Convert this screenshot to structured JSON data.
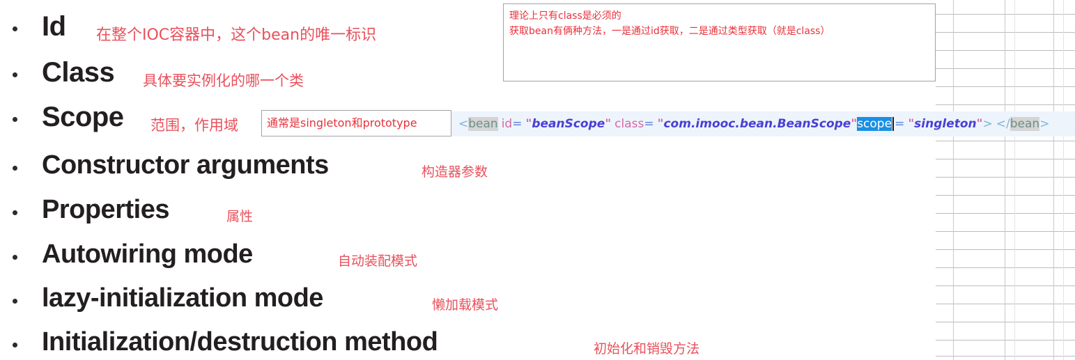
{
  "bullet_list": {
    "items": [
      {
        "term": "Id",
        "annotation": "在整个IOC容器中，这个bean的唯一标识"
      },
      {
        "term": "Class",
        "annotation": "具体要实例化的哪一个类"
      },
      {
        "term": "Scope",
        "annotation": "范围，作用域"
      },
      {
        "term": "Constructor arguments",
        "annotation": "构造器参数"
      },
      {
        "term": "Properties",
        "annotation": "属性"
      },
      {
        "term": "Autowiring mode",
        "annotation": "自动装配模式"
      },
      {
        "term": "lazy-initialization mode",
        "annotation": "懒加载模式"
      },
      {
        "term": "Initialization/destruction  method",
        "annotation": "初始化和销毁方法"
      }
    ]
  },
  "notes": {
    "top_box": {
      "line1": "理论上只有class是必须的",
      "line2": "获取bean有俩种方法，一是通过id获取，二是通过类型获取（就是class）"
    },
    "scope_box": {
      "text": "通常是singleton和prototype"
    }
  },
  "code_line": {
    "open_angle": "<",
    "tag_open": "bean",
    "attr_id": "id",
    "eq1": "=",
    "quote_open_1": "\"",
    "value_id": "beanScope",
    "quote_close_1": "\"",
    "attr_class": "class",
    "eq2": "=",
    "quote_open_2": "\"",
    "value_class": "com.imooc.bean.BeanScope",
    "quote_close_2": "\"",
    "attr_scope_selected": "scope",
    "eq3": "=",
    "quote_open_3": "\"",
    "value_scope": "singleton",
    "quote_close_3": "\"",
    "close_angle": ">",
    "close_tag_open": "</",
    "tag_close": "bean",
    "close_tag_end": ">"
  },
  "colors": {
    "annotation_red": "#e8505b",
    "note_red": "#e8303a",
    "selection_blue": "#1a8fe3",
    "xml_value_blue": "#4a3fd4",
    "xml_attr_pink": "#d46ba3",
    "xml_tag_gray": "#6f8f86",
    "code_strip_bg": "#eef4fc",
    "grid_line": "#c6c9cd"
  }
}
